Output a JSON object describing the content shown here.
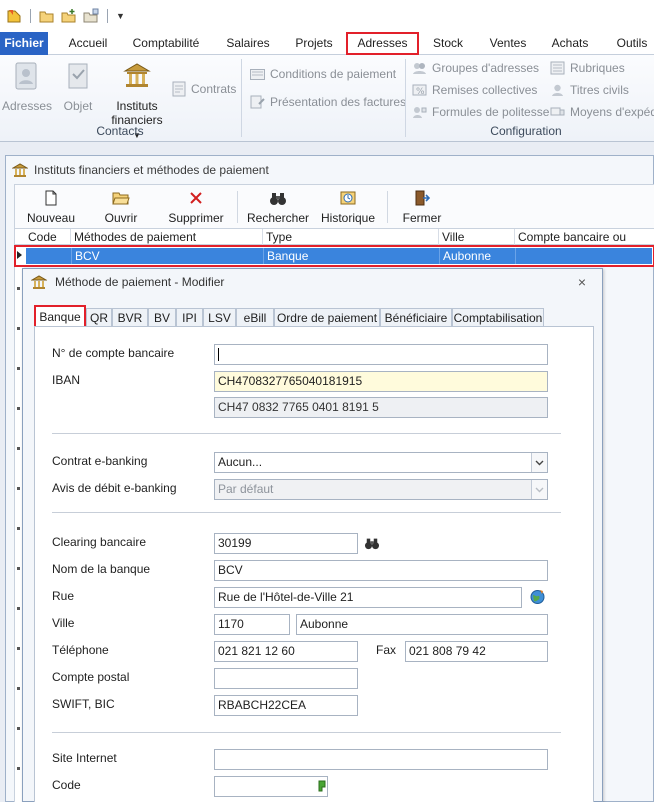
{
  "ribbon_tabs": [
    "Fichier",
    "Accueil",
    "Comptabilité",
    "Salaires",
    "Projets",
    "Adresses",
    "Stock",
    "Ventes",
    "Achats",
    "Outils"
  ],
  "ribbon": {
    "adresses": "Adresses",
    "objet": "Objet",
    "instituts_line1": "Instituts",
    "instituts_line2": "financiers",
    "contrats": "Contrats",
    "group_contacts": "Contacts",
    "conditions": "Conditions de paiement",
    "presentation": "Présentation des factures",
    "groupes": "Groupes d'adresses",
    "remises": "Remises collectives",
    "formules": "Formules de politesse",
    "rubriques": "Rubriques",
    "titres": "Titres civils",
    "moyens": "Moyens d'expéd",
    "group_configuration": "Configuration"
  },
  "window": {
    "title": "Instituts financiers et méthodes de paiement",
    "toolbar": {
      "nouveau": "Nouveau",
      "ouvrir": "Ouvrir",
      "supprimer": "Supprimer",
      "rechercher": "Rechercher",
      "historique": "Historique",
      "fermer": "Fermer"
    },
    "columns": [
      "Code",
      "Méthodes de paiement",
      "Type",
      "Ville",
      "Compte bancaire ou postal"
    ],
    "row": {
      "code": "",
      "methode": "BCV",
      "type": "Banque",
      "ville": "Aubonne",
      "compte": ""
    }
  },
  "dialog": {
    "title": "Méthode de paiement - Modifier",
    "close": "×",
    "tabs": [
      "Banque",
      "QR",
      "BVR",
      "BV",
      "IPI",
      "LSV",
      "eBill",
      "Ordre de paiement",
      "Bénéficiaire",
      "Comptabilisation"
    ],
    "fields": {
      "compte_label": "N° de compte bancaire",
      "compte_value": "",
      "iban_label": "IBAN",
      "iban_value": "CH4708327765040181915",
      "iban_formatted": "CH47 0832 7765 0401 8191 5",
      "contrat_label": "Contrat e-banking",
      "contrat_value": "Aucun...",
      "avis_label": "Avis de débit e-banking",
      "avis_value": "Par défaut",
      "clearing_label": "Clearing bancaire",
      "clearing_value": "30199",
      "nom_label": "Nom de la banque",
      "nom_value": "BCV",
      "rue_label": "Rue",
      "rue_value": "Rue de l'Hôtel-de-Ville 21",
      "ville_label": "Ville",
      "npa_value": "1170",
      "ville_value": "Aubonne",
      "tel_label": "Téléphone",
      "tel_value": "021 821 12 60",
      "fax_label": "Fax",
      "fax_value": "021 808 79 42",
      "postal_label": "Compte postal",
      "postal_value": "",
      "swift_label": "SWIFT, BIC",
      "swift_value": "RBABCH22CEA",
      "site_label": "Site Internet",
      "site_value": "",
      "code_label": "Code",
      "code_value": ""
    }
  },
  "colors": {
    "file_tab": "#2a64c5",
    "selection": "#3a84dd",
    "highlight": "#e2202a"
  }
}
